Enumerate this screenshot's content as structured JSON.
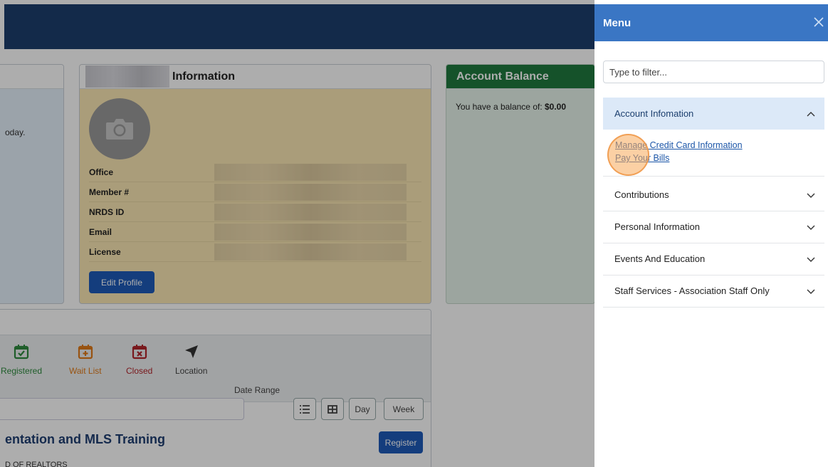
{
  "info_card": {
    "title": "Information",
    "rows": [
      {
        "label": "Office"
      },
      {
        "label": "Member #"
      },
      {
        "label": "NRDS ID"
      },
      {
        "label": "Email"
      },
      {
        "label": "License"
      }
    ],
    "edit_profile_label": "Edit Profile"
  },
  "left_card": {
    "text": "oday."
  },
  "balance_card": {
    "title": "Account Balance",
    "text_prefix": "You have a balance of: ",
    "amount": "$0.00"
  },
  "events": {
    "legend": [
      {
        "label": "Registered",
        "icon": "calendar-check-icon",
        "color": "#2e8b3e"
      },
      {
        "label": "Wait List",
        "icon": "calendar-plus-icon",
        "color": "#e07b1a"
      },
      {
        "label": "Closed",
        "icon": "calendar-x-icon",
        "color": "#b3262c"
      },
      {
        "label": "Location",
        "icon": "location-arrow-icon",
        "color": "#444444"
      }
    ],
    "date_range_label": "Date Range",
    "view_buttons": {
      "list_icon": "list-icon",
      "grid_icon": "grid-icon",
      "day": "Day",
      "week": "Week"
    },
    "event_title": "entation and MLS Training",
    "register_label": "Register",
    "event_sub": "D OF REALTORS"
  },
  "menu": {
    "title": "Menu",
    "close_icon": "close-icon",
    "filter_placeholder": "Type to filter...",
    "sections": [
      {
        "label": "Account Infomation",
        "expanded": true,
        "links": [
          "Manage Credit Card Information",
          "Pay Your Bills"
        ]
      },
      {
        "label": "Contributions",
        "expanded": false
      },
      {
        "label": "Personal Information",
        "expanded": false
      },
      {
        "label": "Events And Education",
        "expanded": false
      },
      {
        "label": "Staff Services - Association Staff Only",
        "expanded": false
      }
    ]
  },
  "colors": {
    "header_blue": "#1c3f6e",
    "menu_header_blue": "#3a76c4",
    "balance_green": "#1f7a3e",
    "button_blue": "#1e5bb8"
  }
}
